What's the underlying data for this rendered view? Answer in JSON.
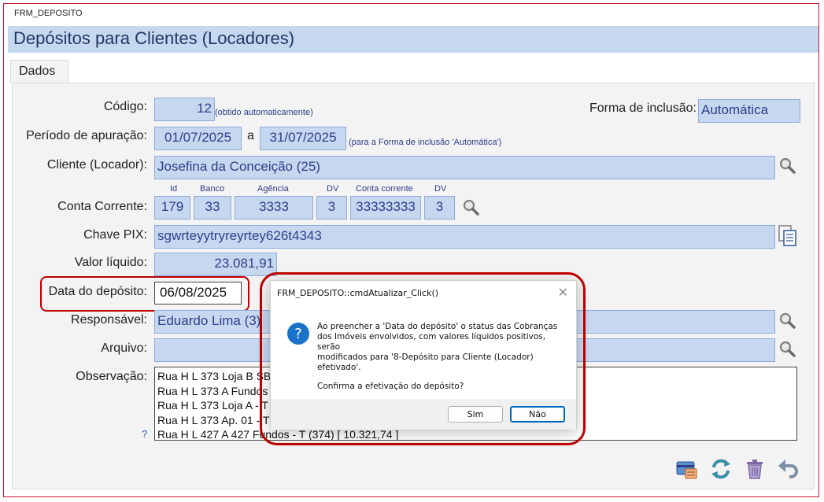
{
  "window": {
    "name": "FRM_DEPOSITO"
  },
  "form": {
    "title": "Depósitos para Clientes (Locadores)",
    "tab": "Dados",
    "codigo": {
      "label": "Código:",
      "value": "12",
      "note": "(obtido automaticamente)"
    },
    "forma_inclusao": {
      "label": "Forma de inclusão:",
      "value": "Automática"
    },
    "periodo": {
      "label": "Período de apuração:",
      "from": "01/07/2025",
      "sep": "a",
      "to": "31/07/2025",
      "note": "(para a Forma de inclusão 'Automática')"
    },
    "cliente": {
      "label": "Cliente (Locador):",
      "value": "Josefina da Conceição (25)"
    },
    "conta": {
      "label": "Conta Corrente:",
      "headers": [
        "Id",
        "Banco",
        "Agência",
        "DV",
        "Conta corrente",
        "DV"
      ],
      "values": [
        "179",
        "33",
        "3333",
        "3",
        "33333333",
        "3"
      ]
    },
    "pix": {
      "label": "Chave PIX:",
      "value": "sgwrteyytryreyrtey626t4343"
    },
    "valor": {
      "label": "Valor líquido:",
      "value": "23.081,91"
    },
    "data_deposito": {
      "label": "Data do depósito:",
      "value": "06/08/2025"
    },
    "responsavel": {
      "label": "Responsável:",
      "value": "Eduardo Lima (3)"
    },
    "arquivo": {
      "label": "Arquivo:",
      "value": ""
    },
    "observacao": {
      "label": "Observação:",
      "help": "?",
      "lines": [
        "Rua H L 373 Loja B  SB",
        "Rua H L 373 A Fundos -",
        "Rua H L 373 Loja A - T (",
        "Rua H L 373 Ap. 01 - T (",
        "Rua H L 427 A 427 Fundos - T (374) [ 10.321,74 ]"
      ]
    }
  },
  "toolbar": {
    "icons": [
      "card-icon",
      "refresh-icon",
      "trash-icon",
      "undo-icon"
    ]
  },
  "dialog": {
    "title": "FRM_DEPOSITO::cmdAtualizar_Click()",
    "close": "✕",
    "message_lines": [
      "Ao preencher a 'Data do depósito' o status das Cobranças",
      "dos Imóveis envolvidos, com valores líquidos positivos, serão",
      "modificados para '8-Depósito para Cliente (Locador)",
      "efetivado'."
    ],
    "question": "Confirma a efetivação do depósito?",
    "yes": "Sim",
    "no": "Não"
  },
  "colors": {
    "field_bg": "#c5d8ef",
    "title_bg": "#c5d8ef",
    "highlight": "#c00000",
    "text_blue": "#2f3e8a"
  }
}
